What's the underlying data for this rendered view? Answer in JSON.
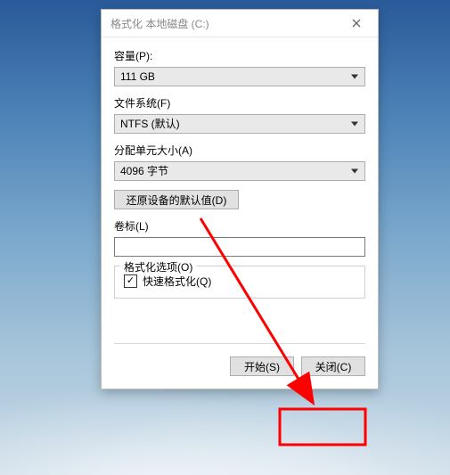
{
  "window": {
    "title": "格式化 本地磁盘 (C:)"
  },
  "capacity": {
    "label": "容量(P):",
    "value": "111 GB"
  },
  "filesystem": {
    "label": "文件系统(F)",
    "value": "NTFS (默认)"
  },
  "allocation": {
    "label": "分配单元大小(A)",
    "value": "4096 字节"
  },
  "restore_defaults": {
    "label": "还原设备的默认值(D)"
  },
  "volume_label": {
    "label": "卷标(L)",
    "value": ""
  },
  "options_group": {
    "legend": "格式化选项(O)",
    "quick_format": {
      "label": "快速格式化(Q)",
      "checked": true
    }
  },
  "buttons": {
    "start": "开始(S)",
    "close": "关闭(C)"
  },
  "annotation": {
    "highlight_target": "close-button",
    "stroke": "#ff0000"
  }
}
